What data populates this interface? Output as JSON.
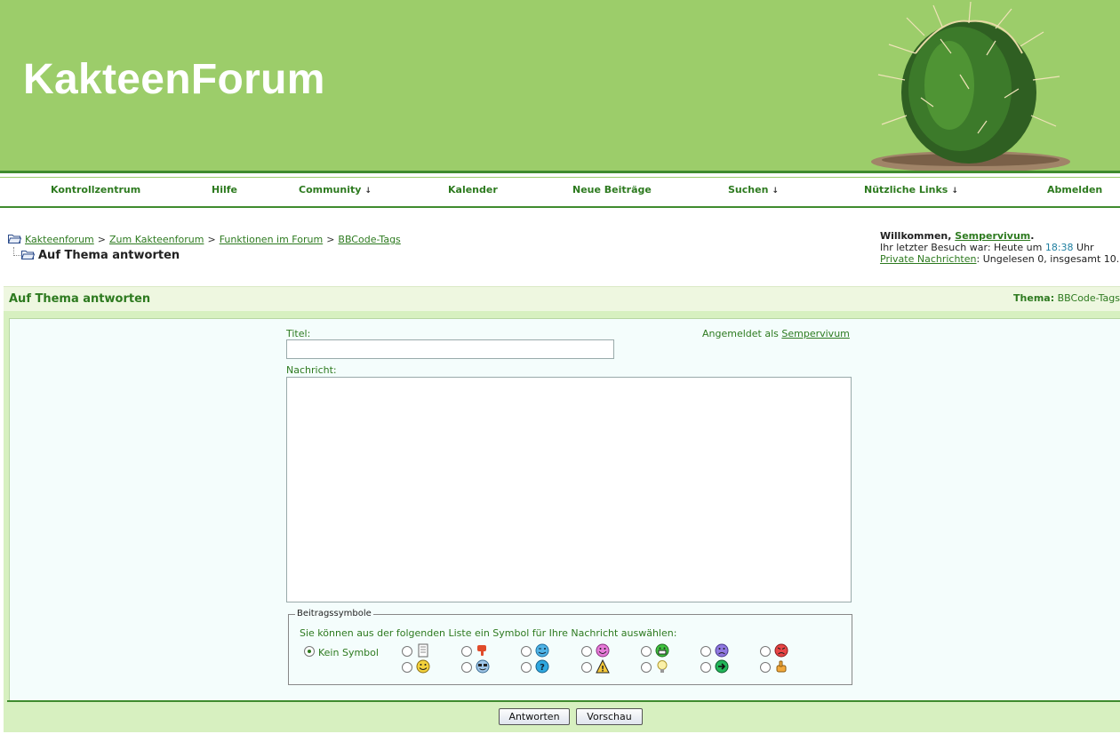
{
  "header": {
    "logo": "KakteenForum"
  },
  "nav": {
    "items": [
      {
        "label": "Kontrollzentrum"
      },
      {
        "label": "Hilfe"
      },
      {
        "label": "Community",
        "arrow": "↓"
      },
      {
        "label": "Kalender"
      },
      {
        "label": "Neue Beiträge"
      },
      {
        "label": "Suchen",
        "arrow": "↓"
      },
      {
        "label": "Nützliche Links",
        "arrow": "↓"
      },
      {
        "label": "Abmelden"
      }
    ]
  },
  "breadcrumb": {
    "items": [
      "Kakteenforum",
      "Zum Kakteenforum",
      "Funktionen im Forum",
      "BBCode-Tags"
    ],
    "separator": ">",
    "current": "Auf Thema antworten"
  },
  "welcome": {
    "greeting": "Willkommen,",
    "username": "Sempervivum",
    "period": ".",
    "last_visit_prefix": "Ihr letzter Besuch war: Heute um",
    "last_visit_time": "18:38",
    "last_visit_suffix": "Uhr",
    "pm_link": "Private Nachrichten",
    "pm_status": ": Ungelesen 0, insgesamt 10."
  },
  "panel": {
    "title": "Auf Thema antworten",
    "topic_label": "Thema:",
    "topic_value": "BBCode-Tags"
  },
  "form": {
    "title_label": "Titel:",
    "title_value": "",
    "message_label": "Nachricht:",
    "message_value": "",
    "logged_in_prefix": "Angemeldet als",
    "logged_in_user": "Sempervivum"
  },
  "icons": {
    "legend": "Beitragssymbole",
    "description": "Sie können aus der folgenden Liste ein Symbol für Ihre Nachricht auswählen:",
    "none_label": "Kein Symbol",
    "selected": "none",
    "row1": [
      "document-icon",
      "thumbs-down-icon",
      "wink-icon",
      "smile-pink-icon",
      "grin-icon",
      "sad-icon",
      "angry-icon"
    ],
    "row2": [
      "smile-icon",
      "cool-icon",
      "question-icon",
      "warning-icon",
      "lightbulb-icon",
      "arrow-right-icon",
      "thumbs-up-icon"
    ]
  },
  "buttons": {
    "submit": "Antworten",
    "preview": "Vorschau"
  },
  "colors": {
    "header_bg": "#9ccd6a",
    "accent_green": "#2d7a1f",
    "panel_bg": "#d7f0c0",
    "form_bg": "#f4fdfc"
  }
}
